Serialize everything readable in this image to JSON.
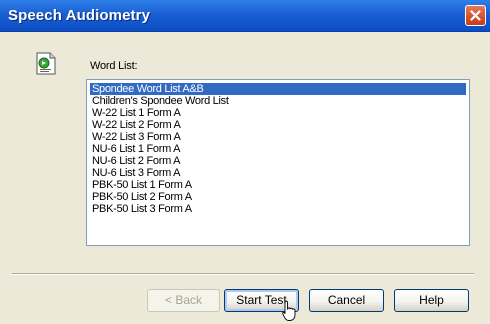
{
  "window": {
    "title": "Speech Audiometry"
  },
  "icons": {
    "close": "close-icon",
    "document": "speech-doc-icon",
    "cursor": "hand-cursor-icon"
  },
  "word_list": {
    "label": "Word List:",
    "selected_index": 0,
    "items": [
      "Spondee Word List A&B",
      "Children's Spondee Word List",
      "W-22 List 1 Form A",
      "W-22 List 2 Form A",
      "W-22 List 3 Form A",
      "NU-6 List 1 Form A",
      "NU-6 List 2 Form A",
      "NU-6 List 3 Form A",
      "PBK-50 List 1 Form A",
      "PBK-50 List 2 Form A",
      "PBK-50 List 3 Form A"
    ]
  },
  "buttons": {
    "back": "< Back",
    "start_test": "Start Test",
    "cancel": "Cancel",
    "help": "Help"
  },
  "colors": {
    "titlebar": "#0d4dc4",
    "selection": "#316ac5",
    "close": "#d4502b"
  }
}
